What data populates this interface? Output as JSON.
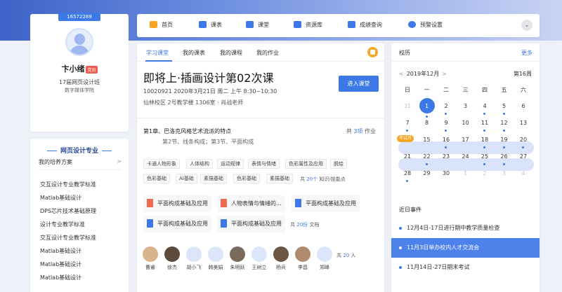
{
  "colors": {
    "accent": "#3d79e6",
    "badge_red": "#f15b4f",
    "orange": "#f5a623"
  },
  "profile": {
    "student_id": "16572289",
    "name": "卞小绪",
    "role_tag": "党员",
    "class_name": "17届网页设计班",
    "department": "数字媒体学院"
  },
  "left_panel": {
    "title": "网页设计专业",
    "plan_label": "我的培养方案",
    "plan_arrow": ">",
    "items": [
      "交互设计专业教学标准",
      "Matlab基础设计",
      "DPS芯片技术基础原理",
      "设计专业教学标准",
      "交互设计专业教学标准",
      "Matlab基础设计",
      "Matlab基础设计",
      "Matlab基础设计"
    ]
  },
  "nav": {
    "items": [
      {
        "label": "首页",
        "icon": "home-icon"
      },
      {
        "label": "课表",
        "icon": "timetable-icon"
      },
      {
        "label": "课堂",
        "icon": "classroom-icon"
      },
      {
        "label": "资源库",
        "icon": "resource-icon"
      },
      {
        "label": "成绩查询",
        "icon": "grade-icon"
      },
      {
        "label": "预警设置",
        "icon": "alert-icon"
      }
    ],
    "toggle": "⌄"
  },
  "main": {
    "tabs": [
      "学习课堂",
      "我的课表",
      "我的课程",
      "我的作业"
    ],
    "class_title": "即将上·插画设计第02次课",
    "class_meta": "10020921  2020年3月21日 周二 上午 8:30~10:30",
    "class_location": "仙林校区 2号教学楼 1306室 · 肖战老师",
    "enter_button": "进入课堂",
    "chapter_title": "第1章、巴洛克风格艺术流派的特点",
    "chapter_hw_prefix": "共 ",
    "chapter_hw_count": "3项",
    "chapter_hw_suffix": " 作业",
    "chapter_sub": "第2节、线条构成；第3节、平面构成",
    "knowledge_points": [
      "卡通人物形象",
      "人体结构",
      "运动规律",
      "表情与情绪",
      "色彩属性及应用",
      "脱绘",
      "色彩基础",
      "AI基础",
      "素描基础",
      "色彩基础",
      "素描基础"
    ],
    "kp_prefix": "共 ",
    "kp_count": "20个",
    "kp_suffix": " 知识/技能点",
    "documents": [
      "平面构成基础及应用",
      "人物表情与情绪的...",
      "平面构成基础及应用",
      "平面构成基础及应用",
      "平面构成基础及应用"
    ],
    "doc_prefix": "共 ",
    "doc_count": "20份",
    "doc_suffix": " 文档",
    "students": [
      "曹睿",
      "徐杰",
      "胡小飞",
      "韩美娟",
      "朱明跃",
      "王树立",
      "杨兵",
      "李昌",
      "郑峰"
    ],
    "stu_prefix": "共 ",
    "stu_count": "20",
    "stu_suffix": " 人"
  },
  "calendar": {
    "title": "校历",
    "more": "更多",
    "month_label": "2019年12月",
    "prev": "<",
    "next": ">",
    "week_label": "第16周",
    "weekdays": [
      "日",
      "一",
      "二",
      "三",
      "四",
      "五",
      "六"
    ],
    "rows": [
      [
        {
          "d": "31",
          "other": true
        },
        {
          "d": "1",
          "today": true,
          "dot": true
        },
        {
          "d": "2",
          "dot": true
        },
        {
          "d": "3"
        },
        {
          "d": "4",
          "dot": true
        },
        {
          "d": "5",
          "dot": true
        },
        {
          "d": "6"
        }
      ],
      [
        {
          "d": "7",
          "dot": true
        },
        {
          "d": "8"
        },
        {
          "d": "9",
          "dot": true
        },
        {
          "d": "10"
        },
        {
          "d": "11",
          "dot": true
        },
        {
          "d": "12",
          "dot": true
        },
        {
          "d": "13"
        }
      ],
      [
        {
          "d": "14"
        },
        {
          "d": "15"
        },
        {
          "d": "16",
          "dot": true
        },
        {
          "d": "17"
        },
        {
          "d": "18",
          "dot": true
        },
        {
          "d": "19",
          "dot": true
        },
        {
          "d": "20",
          "dot": true
        }
      ],
      [
        {
          "d": "21"
        },
        {
          "d": "22",
          "dot": true
        },
        {
          "d": "23"
        },
        {
          "d": "24"
        },
        {
          "d": "25",
          "dot": true
        },
        {
          "d": "26",
          "dot": true
        },
        {
          "d": "27"
        }
      ],
      [
        {
          "d": "28",
          "dot": true
        },
        {
          "d": "29"
        },
        {
          "d": "30"
        },
        {
          "d": "1",
          "other": true
        },
        {
          "d": "2",
          "other": true
        },
        {
          "d": "3",
          "other": true
        },
        {
          "d": "4",
          "other": true
        }
      ]
    ],
    "exam_tag": "考试月",
    "events_title": "近日事件",
    "events": [
      {
        "text": "12月4日-17日进行期中教学质量检查",
        "active": false
      },
      {
        "text": "11月3日举办校内人才交流会",
        "active": true
      },
      {
        "text": "11月14日-27日期末考试",
        "active": false
      }
    ]
  }
}
